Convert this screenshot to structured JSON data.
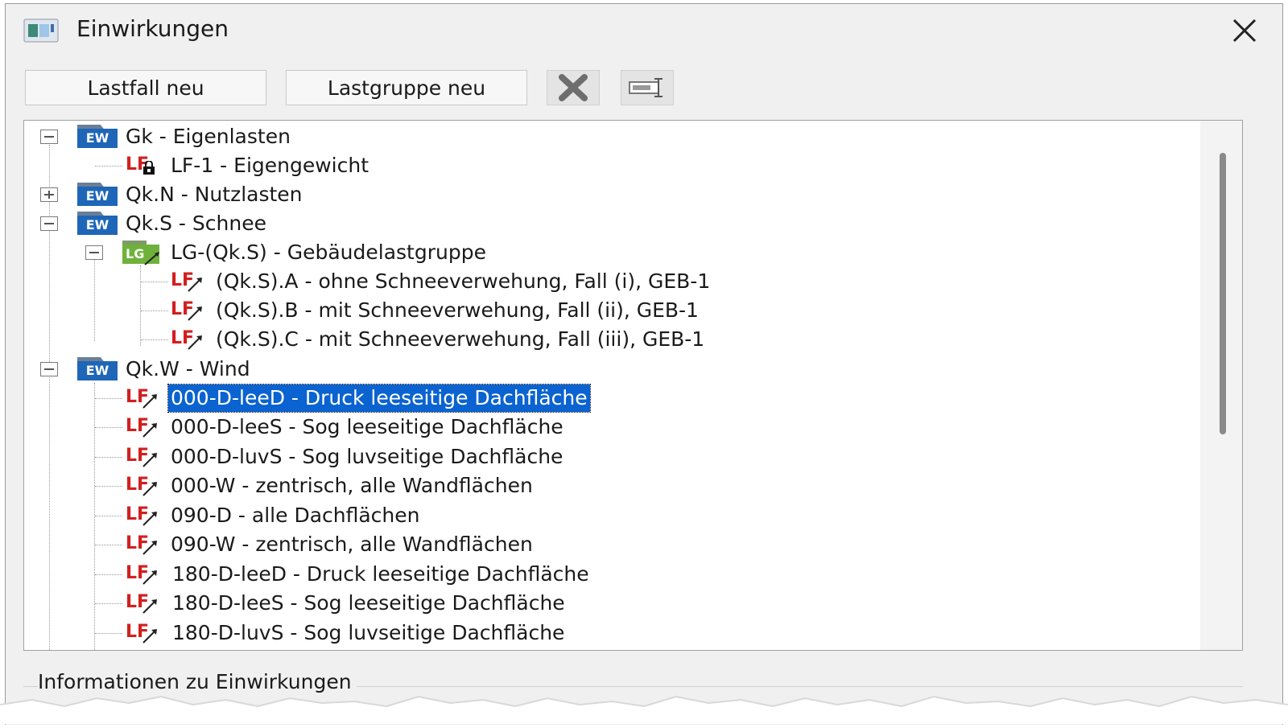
{
  "window": {
    "title": "Einwirkungen",
    "icon": "app-window-icon",
    "close_icon": "close-icon"
  },
  "toolbar": {
    "new_loadcase_label": "Lastfall neu",
    "new_loadgroup_label": "Lastgruppe neu",
    "delete_icon": "delete-x-icon",
    "rename_icon": "rename-field-icon"
  },
  "tree": {
    "nodes": [
      {
        "label": "Gk - Eigenlasten",
        "badge": "EW",
        "level": 0,
        "expander": "minus"
      },
      {
        "label": "LF-1 - Eigengewicht",
        "badge": "LF",
        "level": 1,
        "locked": true
      },
      {
        "label": "Qk.N - Nutzlasten",
        "badge": "EW",
        "level": 0,
        "expander": "plus"
      },
      {
        "label": "Qk.S - Schnee",
        "badge": "EW",
        "level": 0,
        "expander": "minus"
      },
      {
        "label": "LG-(Qk.S) - Gebäudelastgruppe",
        "badge": "LG",
        "level": 1,
        "expander": "minus"
      },
      {
        "label": "(Qk.S).A - ohne Schneeverwehung, Fall (i), GEB-1",
        "badge": "LF",
        "level": 2
      },
      {
        "label": "(Qk.S).B - mit Schneeverwehung, Fall (ii), GEB-1",
        "badge": "LF",
        "level": 2
      },
      {
        "label": "(Qk.S).C - mit Schneeverwehung, Fall (iii), GEB-1",
        "badge": "LF",
        "level": 2
      },
      {
        "label": "Qk.W - Wind",
        "badge": "EW",
        "level": 0,
        "expander": "minus"
      },
      {
        "label": "000-D-leeD - Druck leeseitige Dachfläche",
        "badge": "LF",
        "level": 1,
        "selected": true
      },
      {
        "label": "000-D-leeS - Sog leeseitige Dachfläche",
        "badge": "LF",
        "level": 1
      },
      {
        "label": "000-D-luvS - Sog luvseitige Dachfläche",
        "badge": "LF",
        "level": 1
      },
      {
        "label": "000-W - zentrisch, alle Wandflächen",
        "badge": "LF",
        "level": 1
      },
      {
        "label": "090-D - alle Dachflächen",
        "badge": "LF",
        "level": 1
      },
      {
        "label": "090-W - zentrisch, alle Wandflächen",
        "badge": "LF",
        "level": 1
      },
      {
        "label": "180-D-leeD - Druck leeseitige Dachfläche",
        "badge": "LF",
        "level": 1
      },
      {
        "label": "180-D-leeS - Sog leeseitige Dachfläche",
        "badge": "LF",
        "level": 1
      },
      {
        "label": "180-D-luvS - Sog luvseitige Dachfläche",
        "badge": "LF",
        "level": 1
      }
    ]
  },
  "info": {
    "label": "Informationen zu Einwirkungen"
  },
  "colors": {
    "selection": "#0a63d0",
    "ew_badge": "#1e66b8",
    "lg_badge": "#6fb23b",
    "lf_text": "#d21f1f"
  }
}
